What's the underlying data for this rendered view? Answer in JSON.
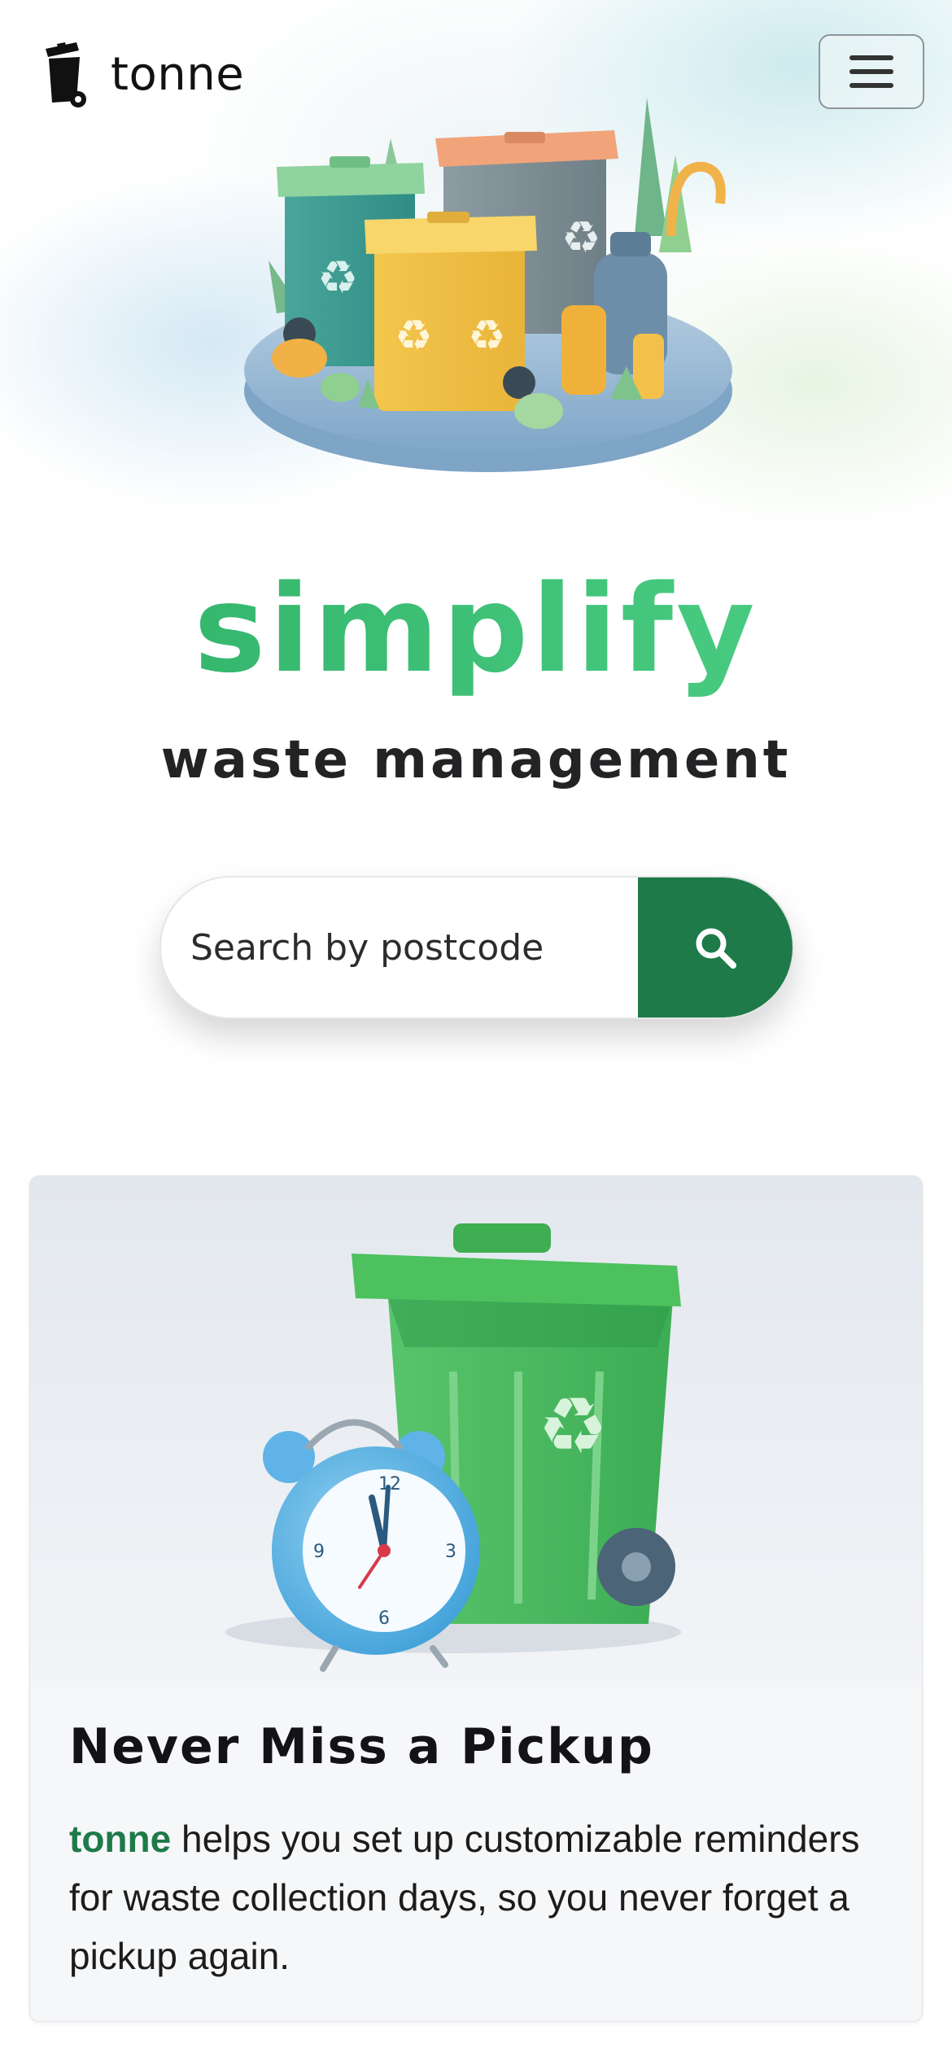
{
  "navbar": {
    "brand_name": "tonne",
    "brand_icon": "wheelie-bin-icon",
    "menu_icon": "hamburger-menu-icon"
  },
  "hero": {
    "illustration": "recycling-bins-illustration",
    "headline": "simplify",
    "subheadline": "waste management"
  },
  "search": {
    "placeholder": "Search by postcode",
    "value": "",
    "button_icon": "search-icon"
  },
  "feature_card": {
    "image": "green-bin-and-alarm-clock",
    "title": "Never Miss a Pickup",
    "brand_highlight": "tonne",
    "body": " helps you set up customizable reminders for waste collection days, so you never forget a pickup again."
  },
  "colors": {
    "accent_green": "#1e7a49",
    "headline_green": "#3fbf70",
    "text_dark": "#1e1e24",
    "card_bg": "#f6f7f9"
  }
}
